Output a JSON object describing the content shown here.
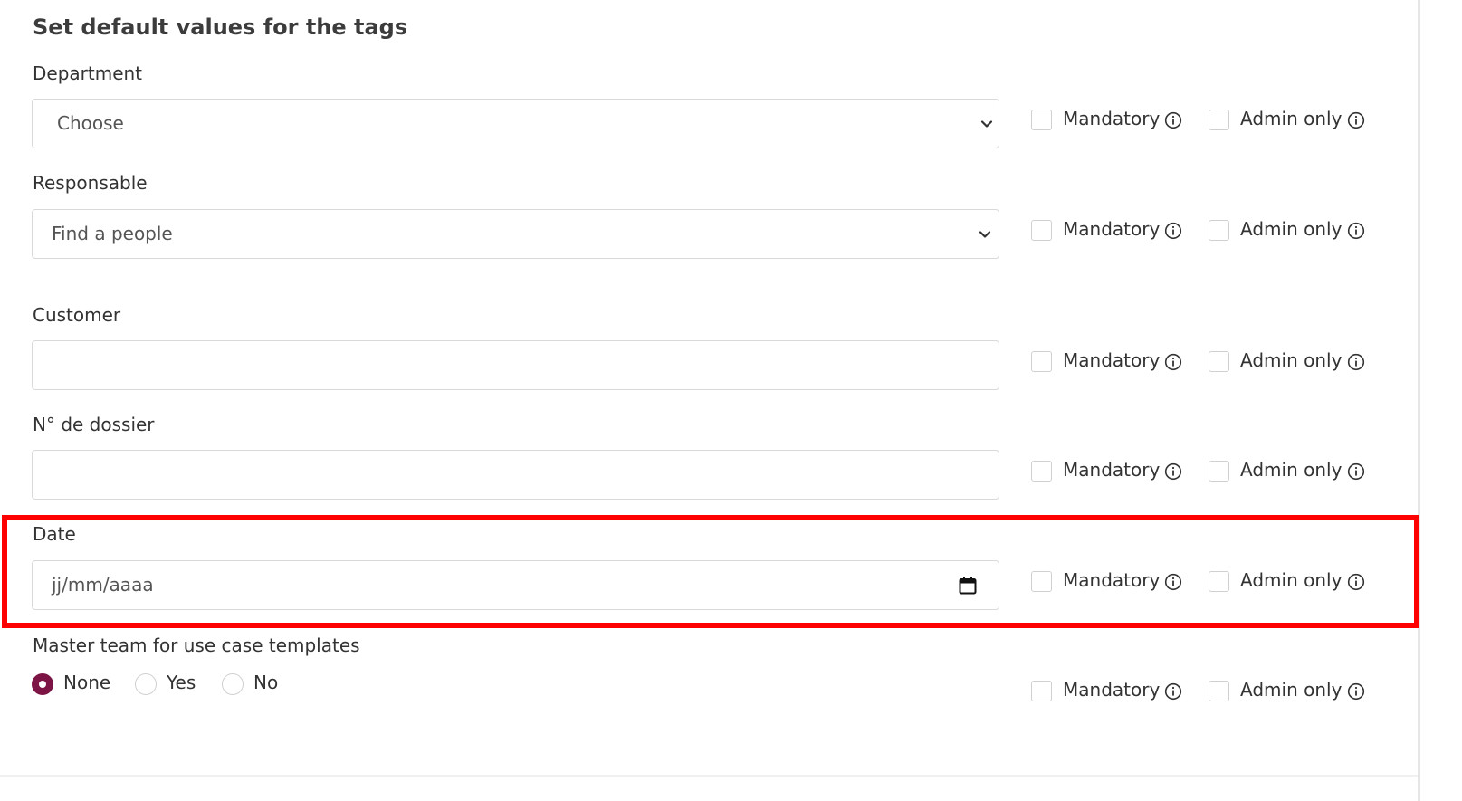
{
  "title": "Set default values for the tags",
  "option_labels": {
    "mandatory": "Mandatory",
    "admin_only": "Admin only"
  },
  "fields": {
    "department": {
      "label": "Department",
      "value": "Choose"
    },
    "responsable": {
      "label": "Responsable",
      "placeholder": "Find a people"
    },
    "customer": {
      "label": "Customer",
      "value": ""
    },
    "dossier": {
      "label": "N° de dossier",
      "value": ""
    },
    "date": {
      "label": "Date",
      "placeholder": "jj/mm/aaaa"
    },
    "master_team": {
      "label": "Master team for use case templates",
      "options": [
        "None",
        "Yes",
        "No"
      ],
      "selected": "None"
    }
  },
  "colors": {
    "accent": "#7d1446",
    "highlight": "#ff0000",
    "border": "#d9d9d9"
  },
  "icons": [
    "chevron-down-icon",
    "calendar-icon",
    "info-icon"
  ]
}
